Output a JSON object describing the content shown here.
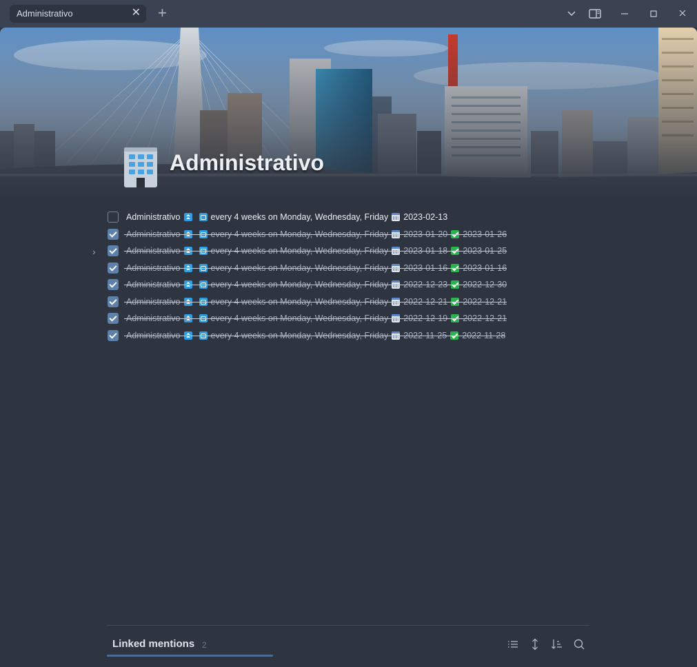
{
  "tab": {
    "label": "Administrativo",
    "close": "✕",
    "new": "+"
  },
  "page": {
    "title": "Administrativo",
    "hr": "- - -"
  },
  "tasks": [
    {
      "done": false,
      "text": "Administrativo",
      "recurrence": "every 4 weeks on Monday, Wednesday, Friday",
      "due": "2023-02-13",
      "completed": ""
    },
    {
      "done": true,
      "text": "Administrativo",
      "recurrence": "every 4 weeks on Monday, Wednesday, Friday",
      "due": "2023-01-20",
      "completed": "2023-01-26"
    },
    {
      "done": true,
      "text": "Administrativo",
      "recurrence": "every 4 weeks on Monday, Wednesday, Friday",
      "due": "2023-01-18",
      "completed": "2023-01-25"
    },
    {
      "done": true,
      "text": "Administrativo",
      "recurrence": "every 4 weeks on Monday, Wednesday, Friday",
      "due": "2023-01-16",
      "completed": "2023-01-16"
    },
    {
      "done": true,
      "text": "Administrativo",
      "recurrence": "every 4 weeks on Monday, Wednesday, Friday",
      "due": "2022-12-23",
      "completed": "2022-12-30"
    },
    {
      "done": true,
      "text": "Administrativo",
      "recurrence": "every 4 weeks on Monday, Wednesday, Friday",
      "due": "2022-12-21",
      "completed": "2022-12-21"
    },
    {
      "done": true,
      "text": "Administrativo",
      "recurrence": "every 4 weeks on Monday, Wednesday, Friday",
      "due": "2022-12-19",
      "completed": "2022-12-21"
    },
    {
      "done": true,
      "text": "Administrativo",
      "recurrence": "every 4 weeks on Monday, Wednesday, Friday",
      "due": "2022-11-25",
      "completed": "2022-11-28"
    }
  ],
  "linked_mentions": {
    "label": "Linked mentions",
    "count": "2"
  },
  "colors": {
    "bg": "#2e3440",
    "titlebar": "#3b4252",
    "accent": "#5e81ac",
    "badge_blue": "#2f9be0",
    "badge_green": "#2bb24c"
  },
  "icons": {
    "page": "office-building-icon",
    "titlebar": [
      "chevron-down-icon",
      "sidebar-toggle-icon",
      "minimize-icon",
      "maximize-icon",
      "close-icon"
    ],
    "linked_mentions": [
      "list-icon",
      "expand-vertical-icon",
      "sort-icon",
      "search-icon"
    ]
  }
}
